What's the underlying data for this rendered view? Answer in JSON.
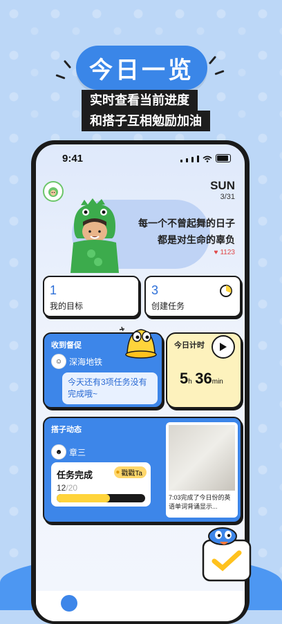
{
  "hero": {
    "title": "今日一览",
    "line1": "实时查看当前进度",
    "line2": "和搭子互相勉励加油"
  },
  "status_bar": {
    "time": "9:41"
  },
  "header": {
    "day": "SUN",
    "date": "3/31"
  },
  "quote": {
    "line1": "每一个不曾起舞的日子",
    "line2": "都是对生命的辜负",
    "likes": "1123"
  },
  "goals": {
    "count": "1",
    "label": "我的目标"
  },
  "tasks": {
    "count": "3",
    "label": "创建任务"
  },
  "reminder": {
    "title": "收到督促",
    "user": "深海地铁",
    "message": "今天还有3项任务没有完成哦~"
  },
  "timer": {
    "title": "今日计时",
    "hours": "5",
    "h_unit": "h",
    "minutes": "36",
    "m_unit": "min"
  },
  "feed": {
    "title": "搭子动态",
    "user": "章三",
    "task_label": "任务完成",
    "poke_label": "戳戳Ta",
    "progress_done": "12",
    "progress_total": "/20",
    "progress_fraction": 0.6,
    "caption": "7:03完成了今日份的英语单词背诵显示..."
  },
  "colors": {
    "accent": "#3d86e9",
    "timer_bg": "#fdf2bd",
    "progress": "#ffd43b"
  }
}
